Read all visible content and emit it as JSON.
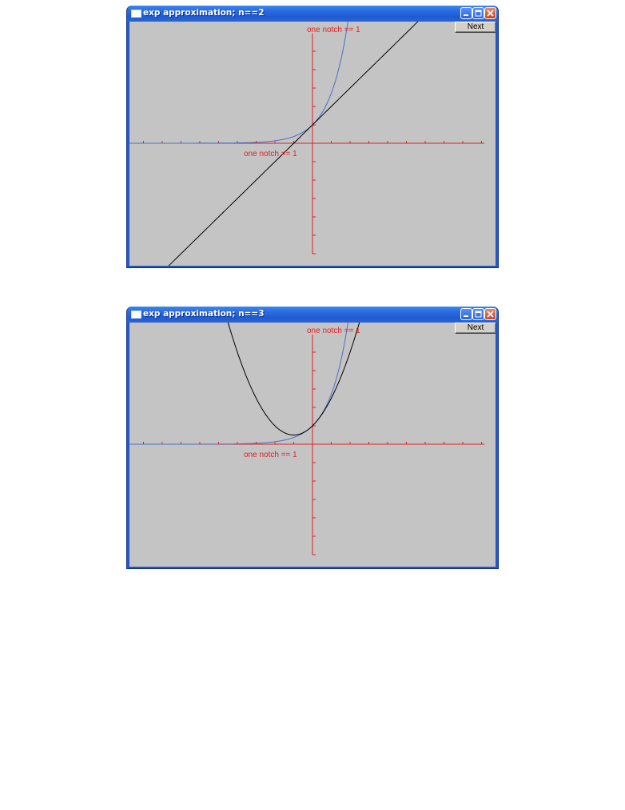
{
  "windows": [
    {
      "title": "exp approximation; n==2",
      "next_label": "Next",
      "x_axis_label": "one notch == 1",
      "y_axis_label": "one notch == 1"
    },
    {
      "title": "exp approximation; n==3",
      "next_label": "Next",
      "x_axis_label": "one notch == 1",
      "y_axis_label": "one notch == 1"
    }
  ],
  "colors": {
    "axis": "#e02020",
    "exp_curve": "#4a6fc8",
    "approx_curve": "#000000",
    "canvas": "#c4c4c4"
  },
  "chart_data": [
    {
      "type": "line",
      "xlim": [
        -9,
        9
      ],
      "ylim": [
        -6,
        6
      ],
      "tick_step": 1,
      "series": [
        {
          "function": "exp(x)",
          "color": "blue"
        },
        {
          "function": "1 + x",
          "color": "black"
        }
      ]
    },
    {
      "type": "line",
      "xlim": [
        -9,
        9
      ],
      "ylim": [
        -6,
        6
      ],
      "tick_step": 1,
      "series": [
        {
          "function": "exp(x)",
          "color": "blue"
        },
        {
          "function": "1 + x + x^2/2",
          "color": "black"
        }
      ]
    }
  ]
}
